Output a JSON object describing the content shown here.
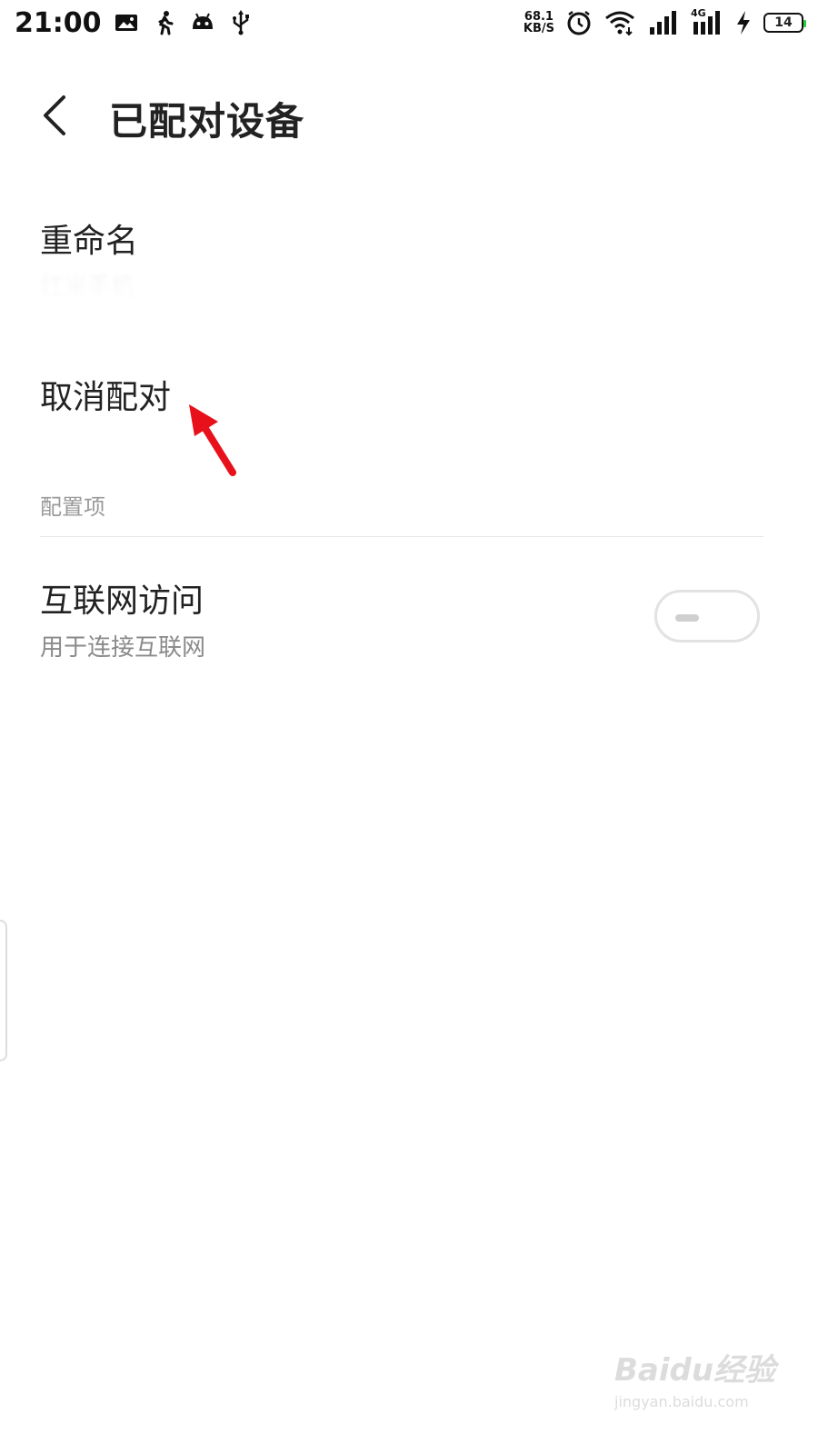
{
  "status_bar": {
    "time": "21:00",
    "net_speed_value": "68.1",
    "net_speed_unit": "KB/S",
    "network_type": "4G",
    "battery_level": "14",
    "icons": [
      "image-icon",
      "walk-icon",
      "android-icon",
      "usb-icon",
      "alarm-icon",
      "wifi-icon",
      "signal-icon",
      "signal-4g-icon",
      "charging-icon",
      "battery-icon"
    ]
  },
  "header": {
    "title": "已配对设备",
    "back_icon": "chevron-left-icon"
  },
  "items": {
    "rename": {
      "title": "重命名",
      "subtitle": "红米手机"
    },
    "unpair": {
      "title": "取消配对"
    }
  },
  "section": {
    "label": "配置项"
  },
  "internet": {
    "title": "互联网访问",
    "subtitle": "用于连接互联网",
    "toggle_on": false
  },
  "annotation": {
    "color": "#e8101a",
    "icon": "red-arrow-icon"
  },
  "watermark": {
    "main": "Baidu经验",
    "sub": "jingyan.baidu.com"
  }
}
